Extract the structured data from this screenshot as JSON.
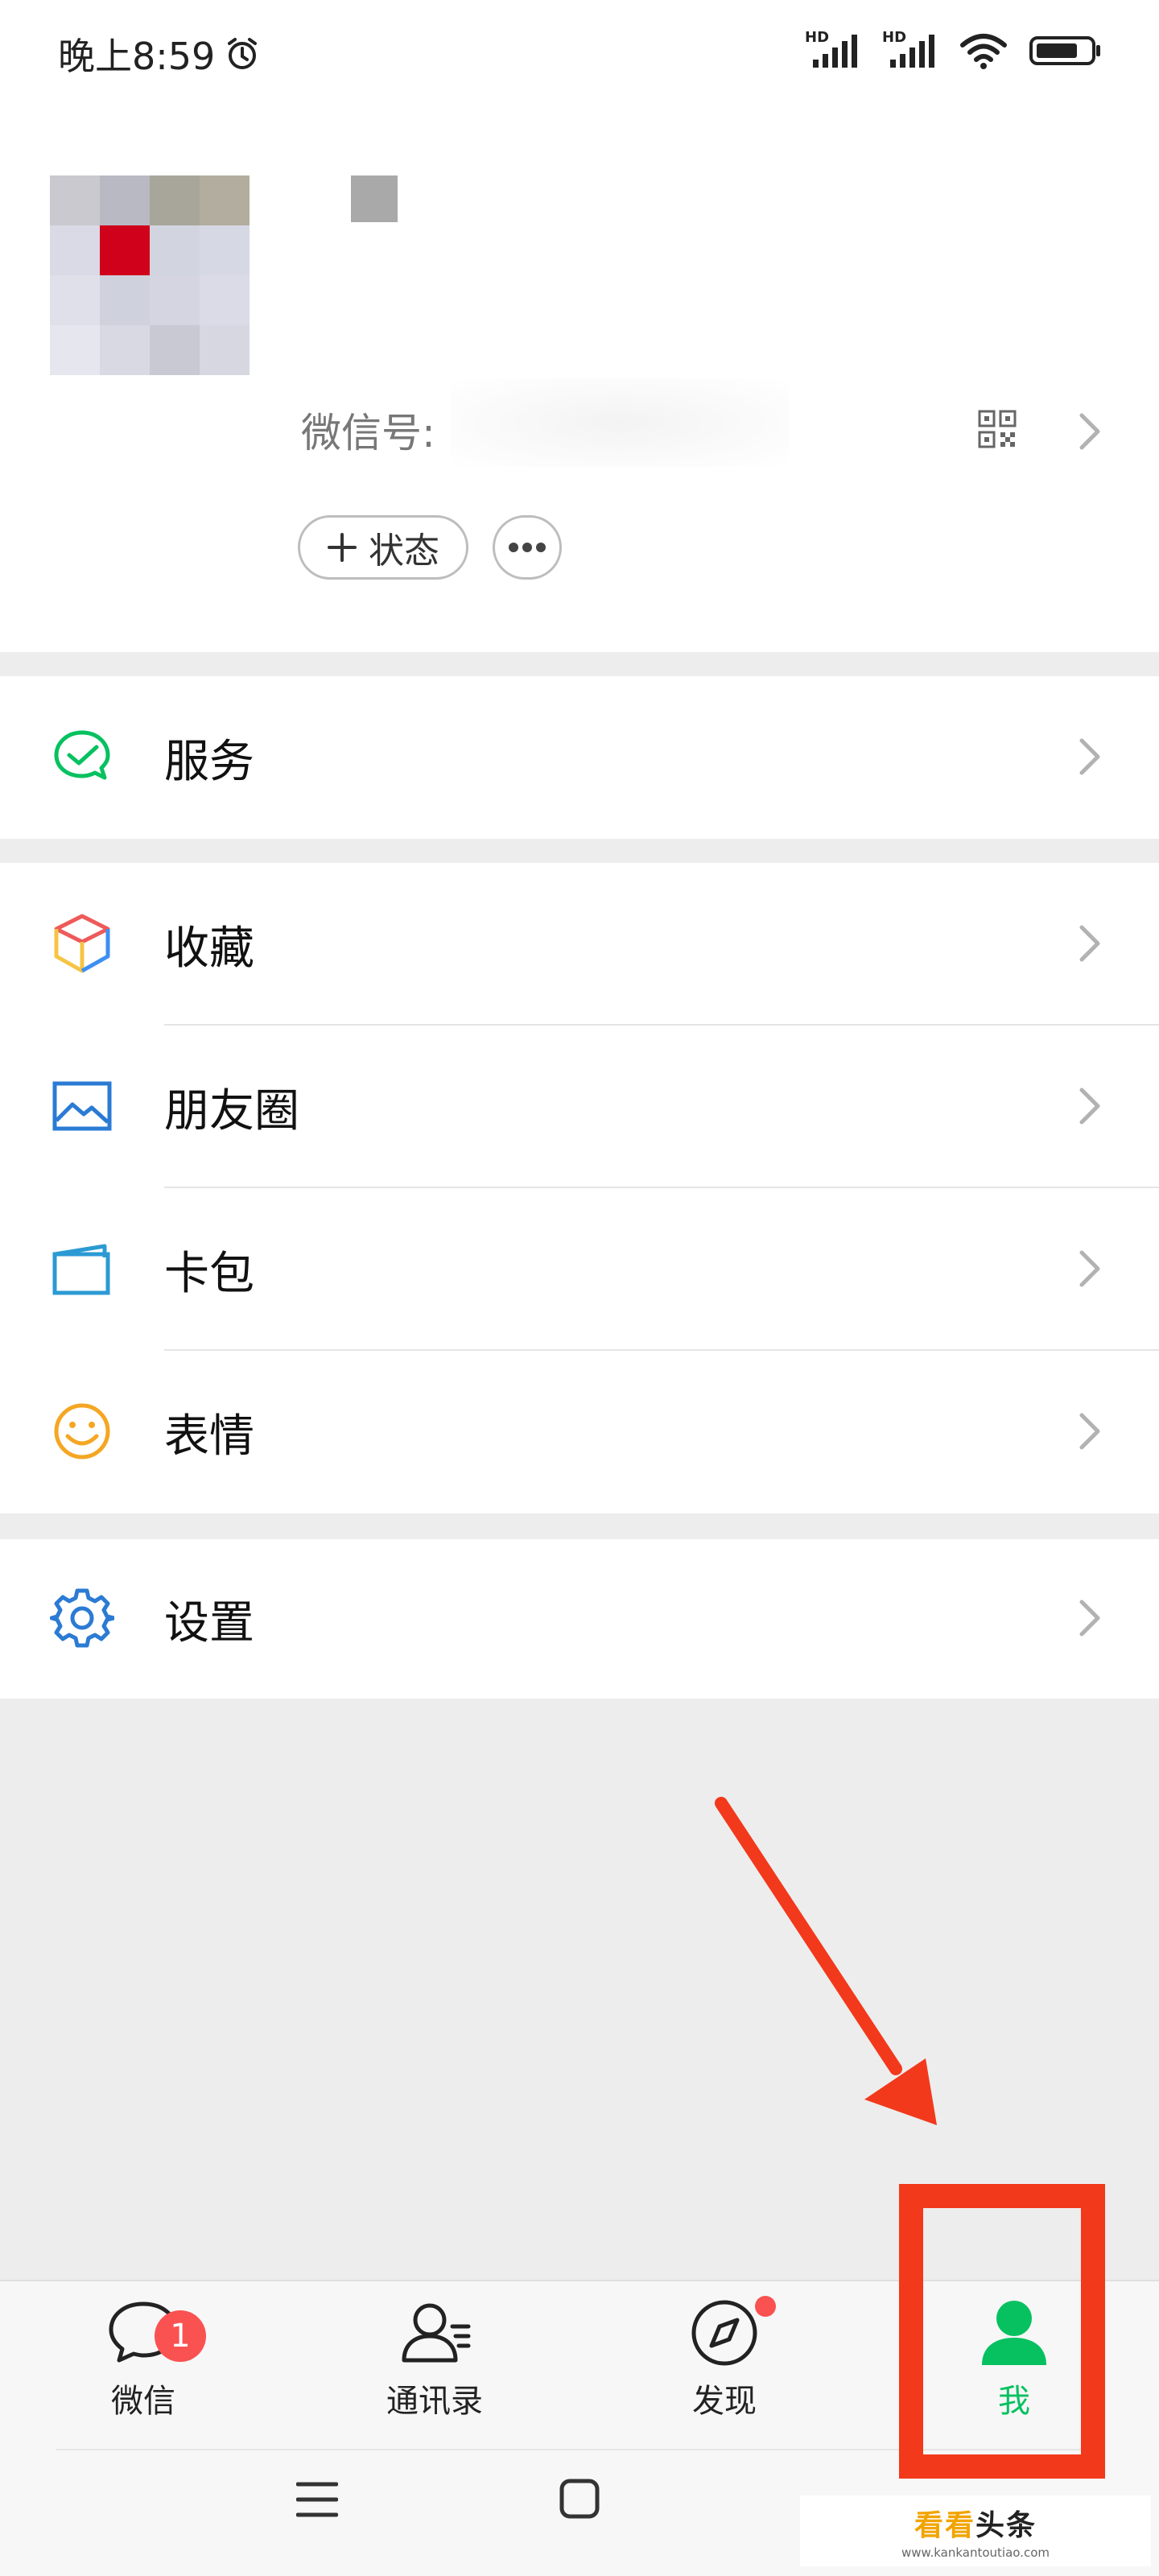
{
  "status_bar": {
    "time": "晚上8:59",
    "signal_1": "HD",
    "signal_2": "HD"
  },
  "profile": {
    "wechat_id_label": "微信号:",
    "status_button": "状态"
  },
  "menu": {
    "services": "服务",
    "favorites": "收藏",
    "moments": "朋友圈",
    "cards": "卡包",
    "stickers": "表情",
    "settings": "设置"
  },
  "tabs": [
    {
      "label": "微信",
      "badge": "1"
    },
    {
      "label": "通讯录"
    },
    {
      "label": "发现"
    },
    {
      "label": "我"
    }
  ],
  "watermark": {
    "brand_a": "看看",
    "brand_b": "头条",
    "url": "www.kankantoutiao.com"
  },
  "colors": {
    "accent": "#07c160",
    "badge": "#fa5151",
    "annotation": "#f2391c"
  }
}
